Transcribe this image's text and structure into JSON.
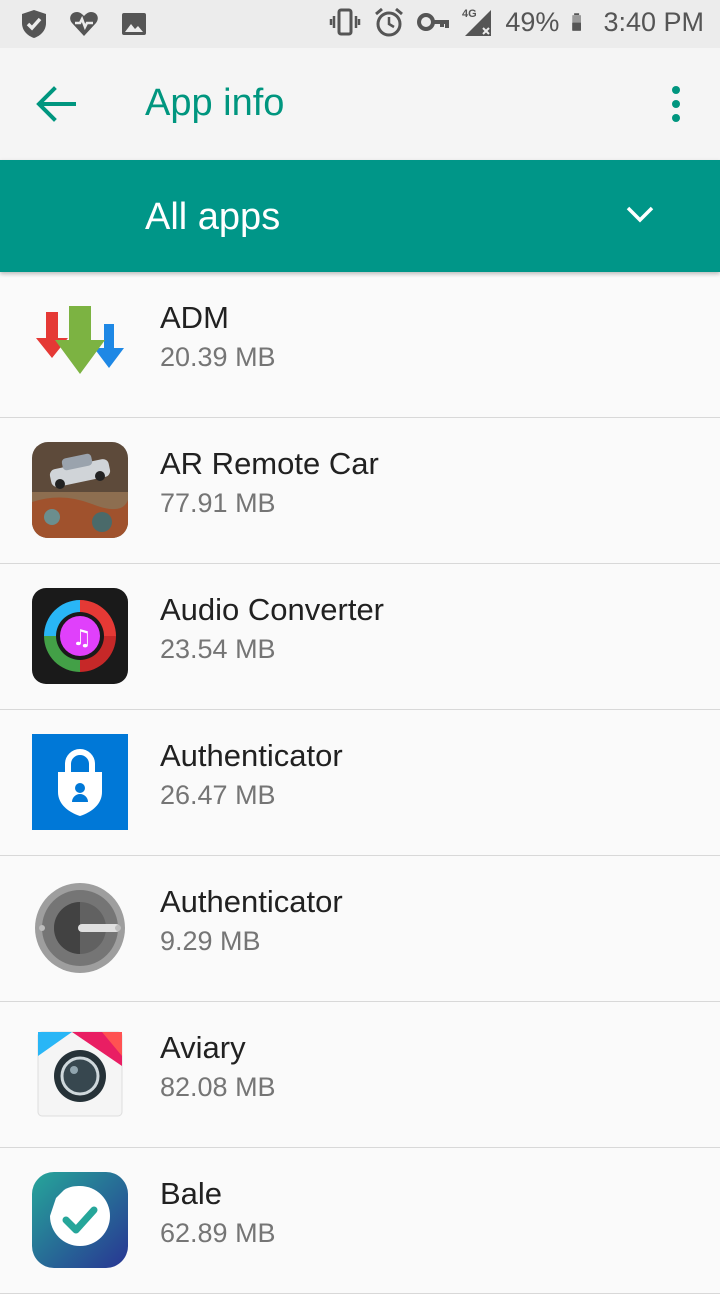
{
  "status_bar": {
    "battery": "49%",
    "time": "3:40 PM",
    "network": "4G",
    "icons": [
      "vpn-shield-icon",
      "heart-pulse-icon",
      "gallery-icon",
      "vibrate-icon",
      "alarm-icon",
      "key-icon",
      "signal-icon",
      "battery-icon"
    ]
  },
  "app_bar": {
    "title": "App info",
    "back_icon": "back-arrow-icon",
    "menu_icon": "more-vert-icon"
  },
  "filter": {
    "selected": "All apps",
    "icon": "chevron-down-icon"
  },
  "apps": [
    {
      "name": "ADM",
      "size": "20.39 MB",
      "icon": "adm-icon"
    },
    {
      "name": "AR Remote Car",
      "size": "77.91 MB",
      "icon": "ar-remote-car-icon"
    },
    {
      "name": "Audio Converter",
      "size": "23.54 MB",
      "icon": "audio-converter-icon"
    },
    {
      "name": "Authenticator",
      "size": "26.47 MB",
      "icon": "microsoft-authenticator-icon"
    },
    {
      "name": "Authenticator",
      "size": "9.29 MB",
      "icon": "google-authenticator-icon"
    },
    {
      "name": "Aviary",
      "size": "82.08 MB",
      "icon": "aviary-icon"
    },
    {
      "name": "Bale",
      "size": "62.89 MB",
      "icon": "bale-icon"
    }
  ],
  "colors": {
    "accent": "#009688",
    "title": "#00967f"
  }
}
